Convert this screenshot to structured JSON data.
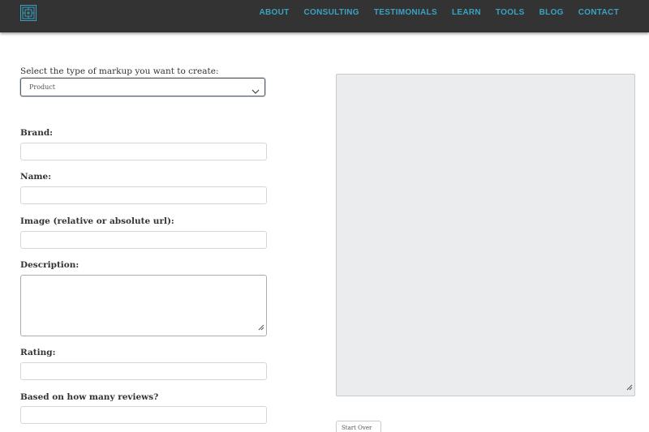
{
  "nav": {
    "items": [
      "ABOUT",
      "CONSULTING",
      "TESTIMONIALS",
      "LEARN",
      "TOOLS",
      "BLOG",
      "CONTACT"
    ]
  },
  "form": {
    "select_label": "Select the type of markup you want to create:",
    "select_value": "Product",
    "fields": {
      "brand": "Brand:",
      "name": "Name:",
      "image": "Image (relative or absolute url):",
      "description": "Description:",
      "rating": "Rating:",
      "reviews": "Based on how many reviews?"
    }
  },
  "output": {
    "button_label": "Start Over"
  },
  "colors": {
    "topbar": "#333333",
    "accent": "#3aa3c3",
    "output_bg": "#eaeced"
  },
  "icons": {
    "logo": "maze-logo-icon",
    "select": "chevron-down-icon",
    "resize": "resize-grip-icon"
  }
}
